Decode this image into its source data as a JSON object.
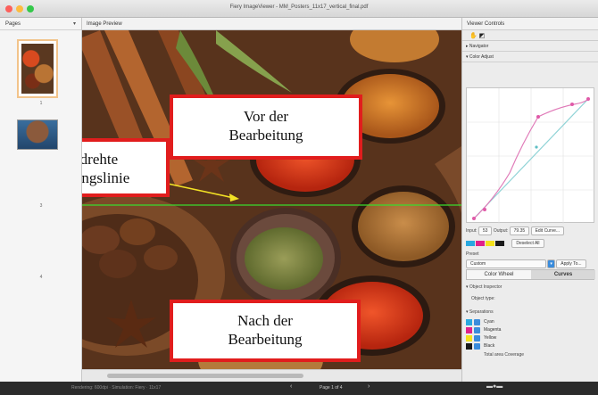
{
  "window": {
    "title": "Fiery ImageViewer - MM_Posters_11x17_vertical_final.pdf"
  },
  "pages_panel": {
    "header": "Pages",
    "page_numbers": [
      "1",
      "2",
      "3",
      "4"
    ]
  },
  "preview": {
    "header": "Image Preview"
  },
  "callouts": {
    "before_line1": "Vor der",
    "before_line2": "Bearbeitung",
    "split_line1": "Gedrehte",
    "split_line2": "Teilungslinie",
    "after_line1": "Nach der",
    "after_line2": "Bearbeitung"
  },
  "viewer_controls": {
    "header": "Viewer Controls",
    "navigator": "Navigator",
    "color_adjust": "Color Adjust",
    "input_label": "Input:",
    "input_value": "53",
    "output_label": "Output:",
    "output_value": "79.35",
    "edit_curve": "Edit Curve...",
    "deselect_all": "Deselect All",
    "preset_label": "Preset",
    "preset_value": "Custom",
    "apply_to": "Apply To...",
    "tab_color_wheel": "Color Wheel",
    "tab_curves": "Curves",
    "object_inspector": "Object Inspector",
    "object_type": "Object type:",
    "separations": "Separations",
    "sep_items": [
      {
        "label": "Cyan",
        "color": "#29a8e0"
      },
      {
        "label": "Magenta",
        "color": "#e0218a"
      },
      {
        "label": "Yellow",
        "color": "#f4e11b"
      },
      {
        "label": "Black",
        "color": "#1a1a1a"
      }
    ],
    "total_coverage": "Total area Coverage"
  },
  "statusbar": {
    "info": "Rendering: 600dpi · Simulation: Fiery · 11x17",
    "page": "Page 1 of 4"
  }
}
